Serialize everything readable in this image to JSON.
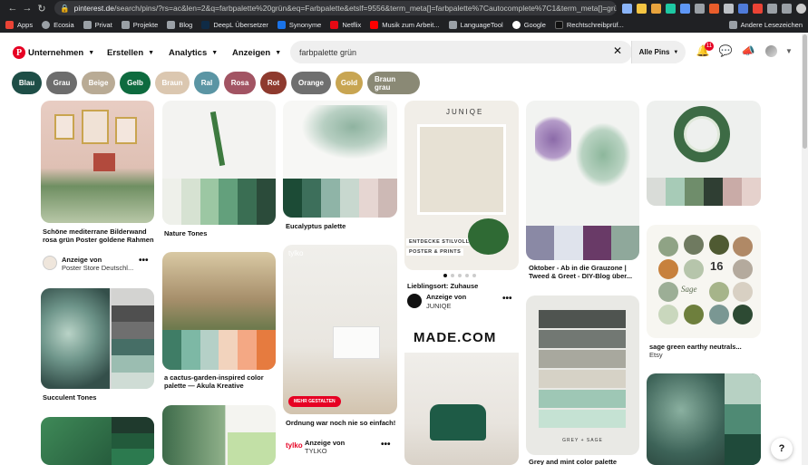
{
  "browser": {
    "url_host": "pinterest.de",
    "url_path": "/search/pins/?rs=ac&len=2&q=farbpalette%20grün&eq=Farbpalette&etslf=9556&term_meta[]=farbpalette%7Cautocomplete%7C1&term_meta[]=grü...",
    "bookmarks": [
      "Apps",
      "Ecosia",
      "Privat",
      "Projekte",
      "Blog",
      "DeepL Übersetzer",
      "Synonyme",
      "Netflix",
      "Musik zum Arbeit...",
      "LanguageTool",
      "Google",
      "Rechtschreibprüf..."
    ],
    "other_bookmarks": "Andere Lesezeichen"
  },
  "header": {
    "menus": [
      "Unternehmen",
      "Erstellen",
      "Analytics",
      "Anzeigen"
    ],
    "search_value": "farbpalette grün",
    "scope": "Alle Pins",
    "notification_count": "11"
  },
  "chips": [
    {
      "label": "Blau",
      "color": "#1e4e47"
    },
    {
      "label": "Grau",
      "color": "#6d6d6d"
    },
    {
      "label": "Beige",
      "color": "#b9ab95"
    },
    {
      "label": "Gelb",
      "color": "#0e6b3f"
    },
    {
      "label": "Braun",
      "color": "#dbc7b0"
    },
    {
      "label": "Ral",
      "color": "#5b95a4"
    },
    {
      "label": "Rosa",
      "color": "#a25463"
    },
    {
      "label": "Rot",
      "color": "#8e3a2e"
    },
    {
      "label": "Orange",
      "color": "#6f6f6f"
    },
    {
      "label": "Gold",
      "color": "#c8a552"
    },
    {
      "label": "Braun grau",
      "color": "#8a8975"
    }
  ],
  "pins": {
    "p1": {
      "title": "Schöne mediterrane Bilderwand rosa grün Poster goldene Rahmen",
      "ad": "Anzeige von",
      "author": "Poster Store Deutschl..."
    },
    "p2": {
      "title": "Succulent Tones"
    },
    "p3": {
      "title": "Nature Tones"
    },
    "p4": {
      "title": "a cactus-garden-inspired color palette — Akula Kreative"
    },
    "p5": {
      "title": "Eucalyptus palette"
    },
    "p6": {
      "brand": "tylko",
      "cta": "MEHR GESTALTEN",
      "title": "Ordnung war noch nie so einfach!",
      "ad": "Anzeige von",
      "author": "TYLKO"
    },
    "p7": {
      "brand": "JUNIQE",
      "overlay1": "ENTDECKE STILVOLLE",
      "overlay2": "POSTER & PRINTS",
      "title": "Lieblingsort: Zuhause",
      "ad": "Anzeige von",
      "author": "JUNIQE"
    },
    "p8": {
      "brand": "MADE.COM"
    },
    "p9": {
      "title": "Oktober - Ab in die Grauzone | Tweed & Greet - DIY-Blog über...",
      "caption": "GREY + SAGE"
    },
    "p10": {
      "title": "Grey and mint color palette"
    },
    "p11": {
      "title": "sage green earthy neutrals...",
      "source": "Etsy",
      "num": "16",
      "word": "Sage"
    }
  },
  "help_label": "?"
}
